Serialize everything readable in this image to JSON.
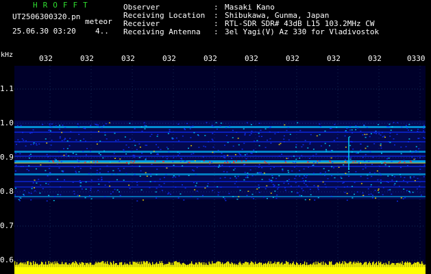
{
  "header": {
    "app_title": "HROFFT",
    "file_name": "UT2506300320.pn",
    "detect_type": "meteor",
    "timestamp": "25.06.30 03:20",
    "detect_count": "4.."
  },
  "info": [
    {
      "key": "Observer",
      "sep": ":",
      "value": "Masaki Kano"
    },
    {
      "key": "Receiving Location",
      "sep": ":",
      "value": "Shibukawa, Gunma, Japan"
    },
    {
      "key": "Receiver",
      "sep": ":",
      "value": "RTL-SDR SDR# 43dB L15 103.2MHz CW"
    },
    {
      "key": "Receiving Antenna",
      "sep": ":",
      "value": "3el Yagi(V) Az 330 for Vladivostok"
    }
  ],
  "axis": {
    "y_unit": "kHz",
    "time_ticks": [
      "032",
      "032",
      "032",
      "032",
      "032",
      "032",
      "032",
      "032",
      "032",
      "0330"
    ],
    "freq_ticks": [
      "1.1",
      "1.0",
      "0.9",
      "0.8",
      "0.7",
      "0.6"
    ]
  },
  "colors": {
    "background": "#000000",
    "plot_background": "#00002a",
    "title_green": "#2fdc2f",
    "grid": "#3f8fbf",
    "signal_low": "#1030ff",
    "signal_mid": "#00d8ff",
    "signal_high": "#ffe000",
    "signal_peak": "#ff2020",
    "noise_bar": "#ffff00"
  }
}
